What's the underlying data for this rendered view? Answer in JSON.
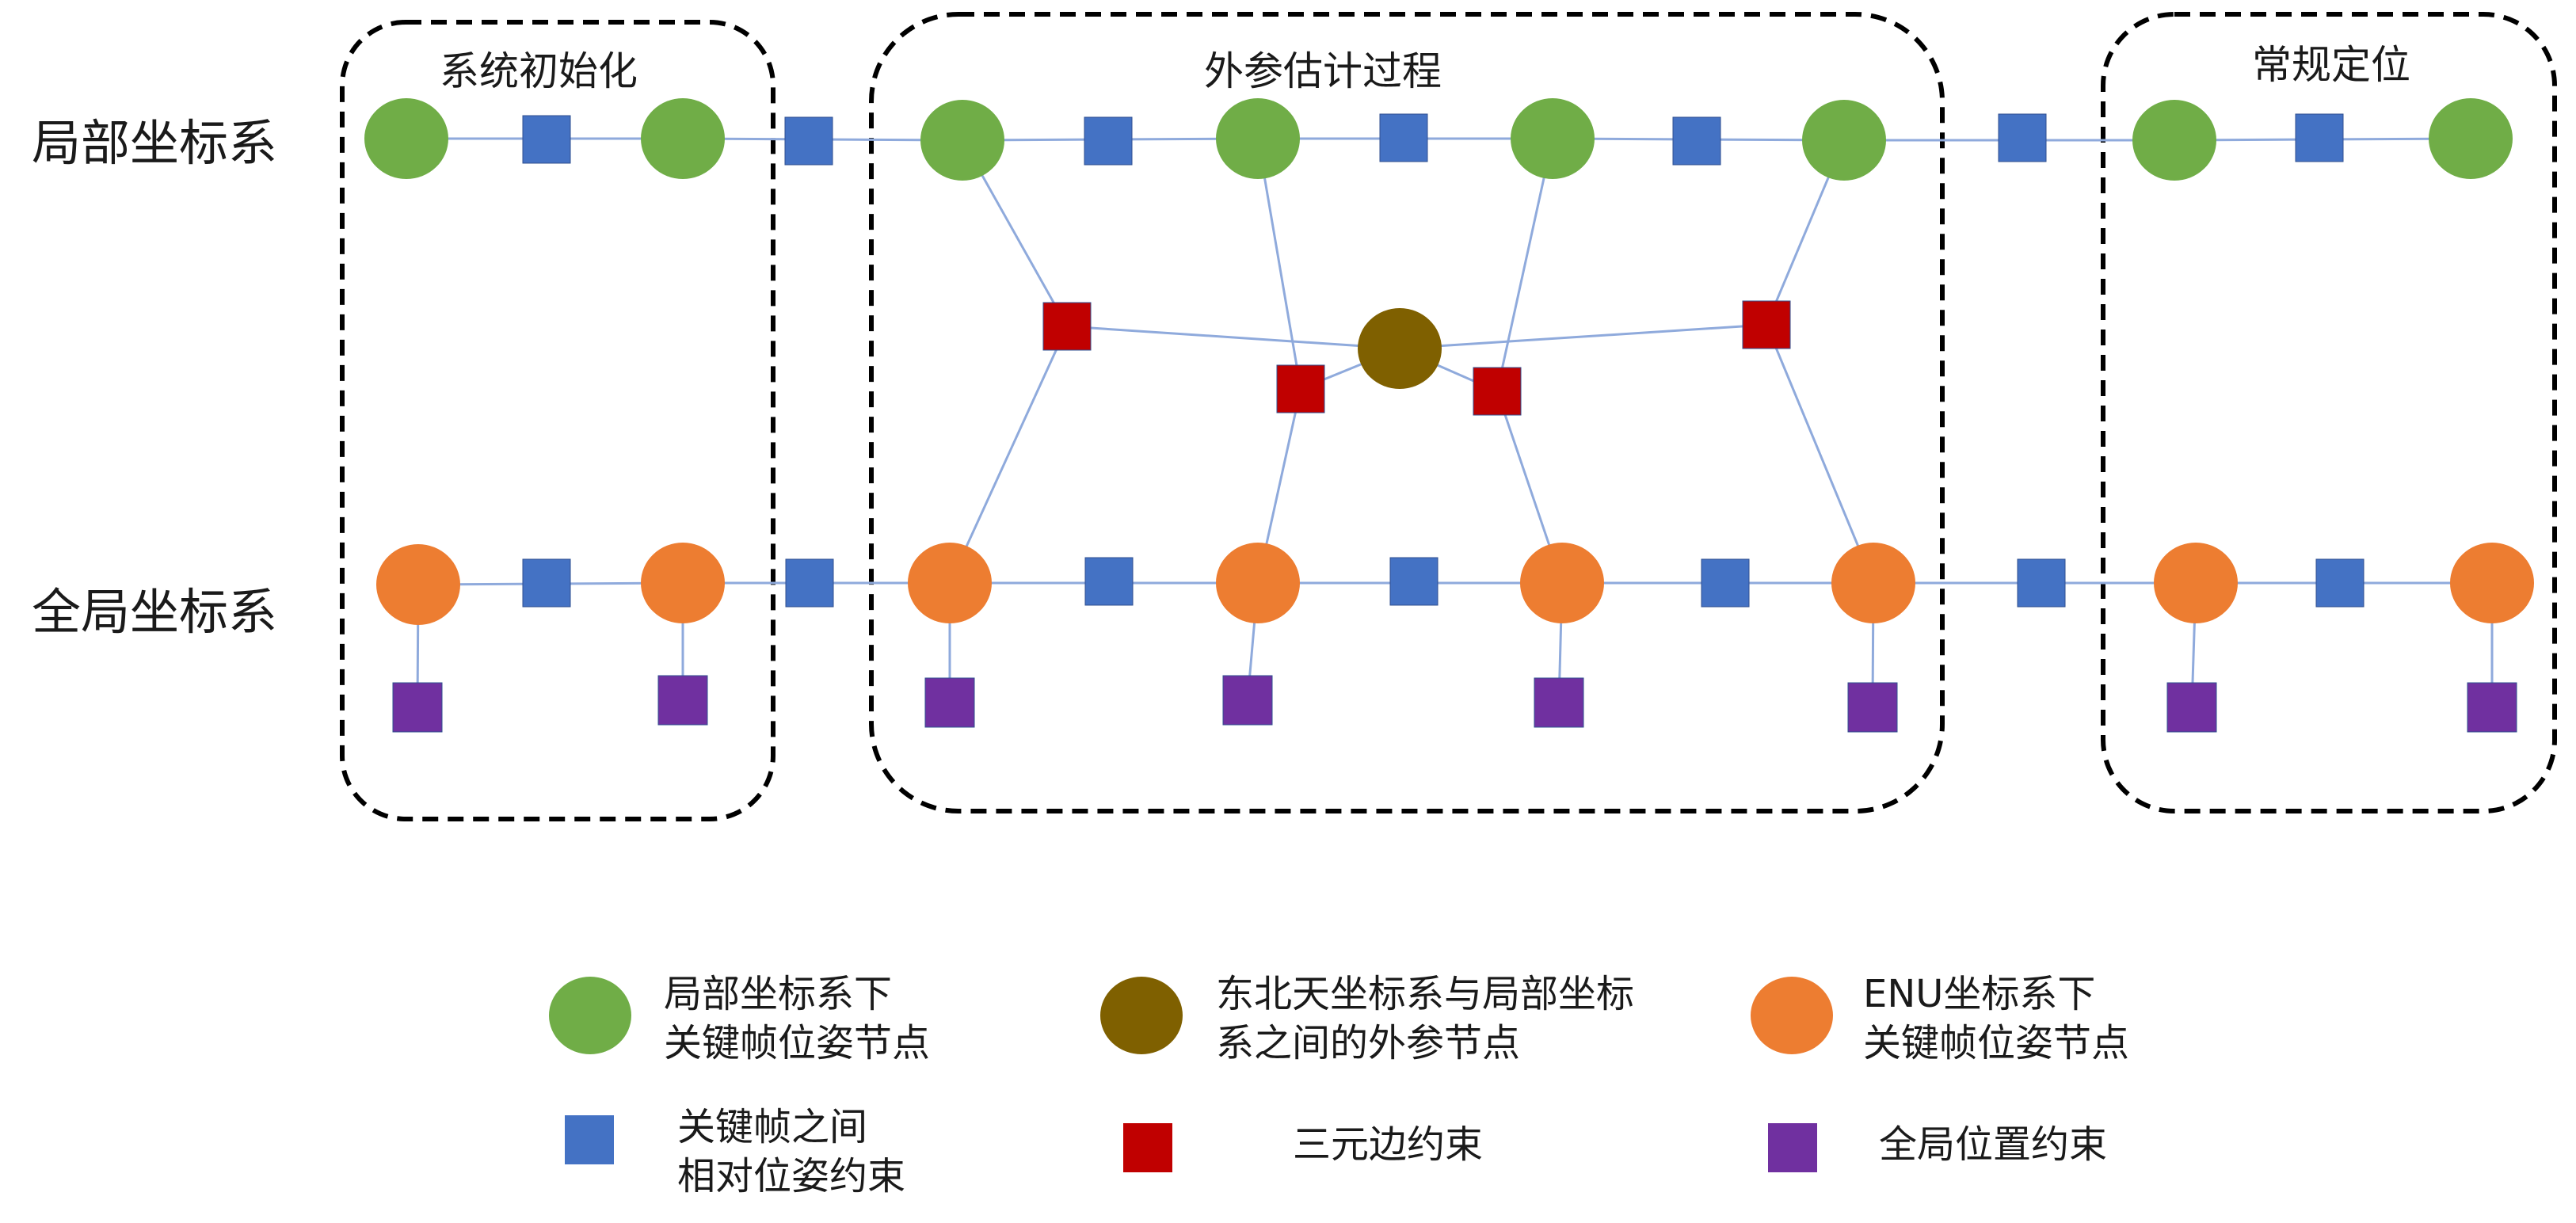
{
  "rows": {
    "local": "局部坐标系",
    "global": "全局坐标系"
  },
  "groups": {
    "init": "系统初始化",
    "calib": "外参估计过程",
    "normal": "常规定位"
  },
  "legend": {
    "local_node": "局部坐标系下\n关键帧位姿节点",
    "extrinsic_node": "东北天坐标系与局部坐标\n系之间的外参节点",
    "enu_node": "ENU坐标系下\n关键帧位姿节点",
    "relative_constraint": "关键帧之间\n相对位姿约束",
    "ternary_constraint": "三元边约束",
    "global_constraint": "全局位置约束"
  },
  "colors": {
    "local_node": "#70ad47",
    "enu_node": "#ed7d31",
    "extrinsic_node": "#7f6000",
    "relative_constraint": "#4472c4",
    "ternary_constraint": "#c00000",
    "global_constraint": "#7030a0",
    "edge": "#8faadc",
    "group_border": "#000000"
  }
}
